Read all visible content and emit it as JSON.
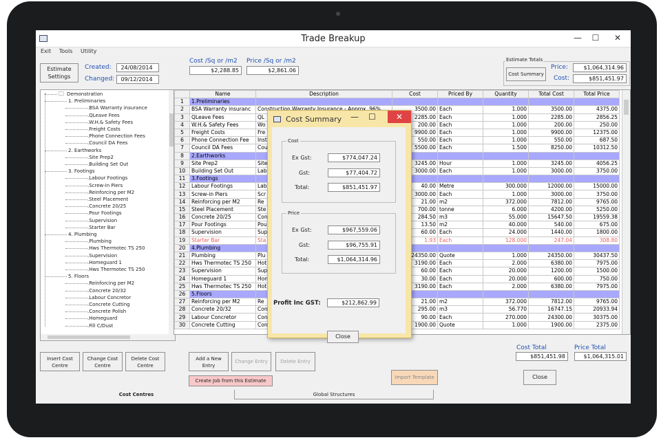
{
  "window": {
    "title": "Trade Breakup",
    "min": "—",
    "max": "☐",
    "close": "✕"
  },
  "menu": [
    "Exit",
    "Tools",
    "Utility"
  ],
  "estimate": {
    "settings_label": "Estimate Settings",
    "created_label": "Created:",
    "created_value": "24/08/2014",
    "changed_label": "Changed:",
    "changed_value": "09/12/2014"
  },
  "rates": {
    "cost_label": "Cost /Sq or /m2",
    "cost_value": "$2,288.85",
    "price_label": "Price /Sq or /m2",
    "price_value": "$2,861.06"
  },
  "totals_box": {
    "title": "Estimate Totals",
    "button": "Cost Summary",
    "price_label": "Price:",
    "price_value": "$1,064,314.96",
    "cost_label": "Cost:",
    "cost_value": "$851,451.97"
  },
  "tree": {
    "root": "Demonstration",
    "groups": [
      {
        "label": "1. Preliminaries",
        "items": [
          "BSA Warranty insurance",
          "QLeave Fees",
          "W.H.& Safety Fees",
          "Freight Costs",
          "Phone Connection Fees",
          "Council DA Fees"
        ]
      },
      {
        "label": "2. Earthworks",
        "items": [
          "Site Prep2",
          "Building Set Out"
        ]
      },
      {
        "label": "3. Footings",
        "items": [
          "Labour Footings",
          "Screw-in Piers",
          "Reinforcing per M2",
          "Steel Placement",
          "Concrete 20/25",
          "Pour Footings",
          "Supervision",
          "Starter Bar"
        ]
      },
      {
        "label": "4. Plumbing",
        "items": [
          "Plumbing",
          "Hws Thermotec TS 250",
          "Supervision",
          "Homeguard 1",
          "Hws Thermotec TS 250"
        ]
      },
      {
        "label": "5. Floors",
        "items": [
          "Reinforcing per M2",
          "Concrete 20/32",
          "Labour Concretor",
          "Concrete Cutting",
          "Concrete Polish",
          "Homeguard",
          "Fill C/Dust"
        ]
      }
    ]
  },
  "grid": {
    "headers": [
      "",
      "Name",
      "Description",
      "Cost",
      "Priced By",
      "Quantity",
      "Total Cost",
      "Total Price"
    ],
    "rows": [
      {
        "n": "1",
        "name": "1.Preliminaries",
        "desc": "",
        "cost": "",
        "by": "",
        "qty": "",
        "tc": "",
        "tp": "",
        "type": "sec"
      },
      {
        "n": "2",
        "name": "BSA Warranty insuranc",
        "desc": "Construction Warranty Insurance - Approx .96%",
        "cost": "3500.00",
        "by": "Each",
        "qty": "1.000",
        "tc": "3500.00",
        "tp": "4375.00",
        "type": ""
      },
      {
        "n": "3",
        "name": "QLeave Fees",
        "desc": "QL",
        "cost": "2285.00",
        "by": "Each",
        "qty": "1.000",
        "tc": "2285.00",
        "tp": "2856.25",
        "type": ""
      },
      {
        "n": "4",
        "name": "W.H.& Safety Fees",
        "desc": "Wo",
        "cost": "200.00",
        "by": "Each",
        "qty": "1.000",
        "tc": "200.00",
        "tp": "250.00",
        "type": ""
      },
      {
        "n": "5",
        "name": "Freight Costs",
        "desc": "Fre",
        "cost": "9900.00",
        "by": "Each",
        "qty": "1.000",
        "tc": "9900.00",
        "tp": "12375.00",
        "type": ""
      },
      {
        "n": "6",
        "name": "Phone Connection Fee",
        "desc": "Inst",
        "cost": "550.00",
        "by": "Each",
        "qty": "1.000",
        "tc": "550.00",
        "tp": "687.50",
        "type": ""
      },
      {
        "n": "7",
        "name": "Council DA Fees",
        "desc": "Cou",
        "cost": "5500.00",
        "by": "Each",
        "qty": "1.500",
        "tc": "8250.00",
        "tp": "10312.50",
        "type": ""
      },
      {
        "n": "8",
        "name": "2.Earthworks",
        "desc": "",
        "cost": "",
        "by": "",
        "qty": "",
        "tc": "",
        "tp": "",
        "type": "sec"
      },
      {
        "n": "9",
        "name": "Site Prep2",
        "desc": "Site",
        "cost": "3245.00",
        "by": "Hour",
        "qty": "1.000",
        "tc": "3245.00",
        "tp": "4056.25",
        "type": ""
      },
      {
        "n": "10",
        "name": "Building Set Out",
        "desc": "Lab",
        "cost": "3000.00",
        "by": "Each",
        "qty": "1.000",
        "tc": "3000.00",
        "tp": "3750.00",
        "type": ""
      },
      {
        "n": "11",
        "name": "3.Footings",
        "desc": "",
        "cost": "",
        "by": "",
        "qty": "",
        "tc": "",
        "tp": "",
        "type": "sec"
      },
      {
        "n": "12",
        "name": "Labour Footings",
        "desc": "Lab",
        "cost": "40.00",
        "by": "Metre",
        "qty": "300.000",
        "tc": "12000.00",
        "tp": "15000.00",
        "type": ""
      },
      {
        "n": "13",
        "name": "Screw-in Piers",
        "desc": "Scr",
        "cost": "3000.00",
        "by": "Each",
        "qty": "1.000",
        "tc": "3000.00",
        "tp": "3750.00",
        "type": ""
      },
      {
        "n": "14",
        "name": "Reinforcing per M2",
        "desc": "Re",
        "cost": "21.00",
        "by": "m2",
        "qty": "372.000",
        "tc": "7812.00",
        "tp": "9765.00",
        "type": ""
      },
      {
        "n": "15",
        "name": "Steel Placement",
        "desc": "Ste",
        "cost": "700.00",
        "by": "tonne",
        "qty": "6.000",
        "tc": "4200.00",
        "tp": "5250.00",
        "type": ""
      },
      {
        "n": "16",
        "name": "Concrete 20/25",
        "desc": "Con",
        "cost": "284.50",
        "by": "m3",
        "qty": "55.000",
        "tc": "15647.50",
        "tp": "19559.38",
        "type": ""
      },
      {
        "n": "17",
        "name": "Pour Footings",
        "desc": "Pou",
        "cost": "13.50",
        "by": "m2",
        "qty": "40.000",
        "tc": "540.00",
        "tp": "675.00",
        "type": ""
      },
      {
        "n": "18",
        "name": "Supervision",
        "desc": "Sup",
        "cost": "60.00",
        "by": "Each",
        "qty": "24.000",
        "tc": "1440.00",
        "tp": "1800.00",
        "type": ""
      },
      {
        "n": "19",
        "name": "Starter Bar",
        "desc": "Sta",
        "cost": "1.93",
        "by": "Each",
        "qty": "128.000",
        "tc": "247.04",
        "tp": "308.80",
        "type": "red"
      },
      {
        "n": "20",
        "name": "4.Plumbing",
        "desc": "",
        "cost": "",
        "by": "",
        "qty": "",
        "tc": "",
        "tp": "",
        "type": "sec"
      },
      {
        "n": "21",
        "name": "Plumbing",
        "desc": "Plu",
        "cost": "24350.00",
        "by": "Quote",
        "qty": "1.000",
        "tc": "24350.00",
        "tp": "30437.50",
        "type": ""
      },
      {
        "n": "22",
        "name": "Hws Thermotec TS 250",
        "desc": "Hot",
        "cost": "3190.00",
        "by": "Each",
        "qty": "2.000",
        "tc": "6380.00",
        "tp": "7975.00",
        "type": ""
      },
      {
        "n": "23",
        "name": "Supervision",
        "desc": "Sup",
        "cost": "60.00",
        "by": "Each",
        "qty": "20.000",
        "tc": "1200.00",
        "tp": "1500.00",
        "type": ""
      },
      {
        "n": "24",
        "name": "Homeguard 1",
        "desc": "Hon",
        "cost": "30.00",
        "by": "Each",
        "qty": "20.000",
        "tc": "600.00",
        "tp": "750.00",
        "type": ""
      },
      {
        "n": "25",
        "name": "Hws Thermotec TS 250",
        "desc": "Hot",
        "cost": "3190.00",
        "by": "Each",
        "qty": "2.000",
        "tc": "6380.00",
        "tp": "7975.00",
        "type": ""
      },
      {
        "n": "26",
        "name": "5.Floors",
        "desc": "",
        "cost": "",
        "by": "",
        "qty": "",
        "tc": "",
        "tp": "",
        "type": "sec"
      },
      {
        "n": "27",
        "name": "Reinforcing per M2",
        "desc": "Re",
        "cost": "21.00",
        "by": "m2",
        "qty": "372.000",
        "tc": "7812.00",
        "tp": "9765.00",
        "type": ""
      },
      {
        "n": "28",
        "name": "Concrete 20/32",
        "desc": "Con",
        "cost": "295.00",
        "by": "m3",
        "qty": "56.770",
        "tc": "16747.15",
        "tp": "20933.94",
        "type": ""
      },
      {
        "n": "29",
        "name": "Labour Concretor",
        "desc": "Con",
        "cost": "90.00",
        "by": "Each",
        "qty": "270.000",
        "tc": "24300.00",
        "tp": "30375.00",
        "type": ""
      },
      {
        "n": "30",
        "name": "Concrete Cutting",
        "desc": "Con",
        "cost": "1900.00",
        "by": "Quote",
        "qty": "1.000",
        "tc": "1900.00",
        "tp": "2375.00",
        "type": ""
      }
    ]
  },
  "dialog": {
    "title": "Cost Summary",
    "cost_group": "Cost",
    "price_group": "Price",
    "ex_gst_label": "Ex Gst:",
    "gst_label": "Gst:",
    "total_label": "Total:",
    "cost_ex": "$774,047.24",
    "cost_gst": "$77,404.72",
    "cost_total": "$851,451.97",
    "price_ex": "$967,559.06",
    "price_gst": "$96,755.91",
    "price_total": "$1,064,314.96",
    "profit_label": "Profit Inc GST:",
    "profit_value": "$212,862.99",
    "close": "Close"
  },
  "bottom": {
    "insert_cc": "Insert Cost Centre",
    "change_cc": "Change Cost Centre",
    "delete_cc": "Delete Cost Centre",
    "add_entry": "Add a New Entry",
    "change_entry": "Change Entry",
    "delete_entry": "Delete Entry",
    "create_job": "Create Job from this Estimate",
    "import_template": "Import Template",
    "cost_total_label": "Cost Total",
    "cost_total_value": "$851,451.98",
    "price_total_label": "Price Total",
    "price_total_value": "$1,064,315.01",
    "close": "Close"
  },
  "tabs": [
    "Cost Centres",
    "Global Structures"
  ],
  "colors": {
    "section": "#a8a8ff",
    "link": "#2050b0",
    "dialog_frame": "#f8e6a8",
    "close_red": "#e04343",
    "create_job": "#f8c8c8",
    "import_template": "#f8d8b8"
  }
}
